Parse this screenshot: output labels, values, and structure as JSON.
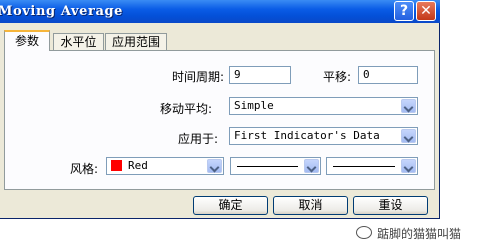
{
  "window": {
    "title": "Moving Average",
    "help_button": "?",
    "close_button": "✕"
  },
  "tabs": [
    {
      "label": "参数",
      "active": true
    },
    {
      "label": "水平位",
      "active": false
    },
    {
      "label": "应用范围",
      "active": false
    }
  ],
  "params": {
    "period_label": "时间周期:",
    "period_value": "9",
    "shift_label": "平移:",
    "shift_value": "0",
    "ma_method_label": "移动平均:",
    "ma_method_value": "Simple",
    "apply_to_label": "应用于:",
    "apply_to_value": "First Indicator's Data",
    "style_label": "风格:",
    "color_value": "Red",
    "color_hex": "#ff0000"
  },
  "buttons": {
    "ok": "确定",
    "cancel": "取消",
    "reset": "重设"
  },
  "watermark": {
    "text": "踮脚的猫猫叫猫"
  }
}
